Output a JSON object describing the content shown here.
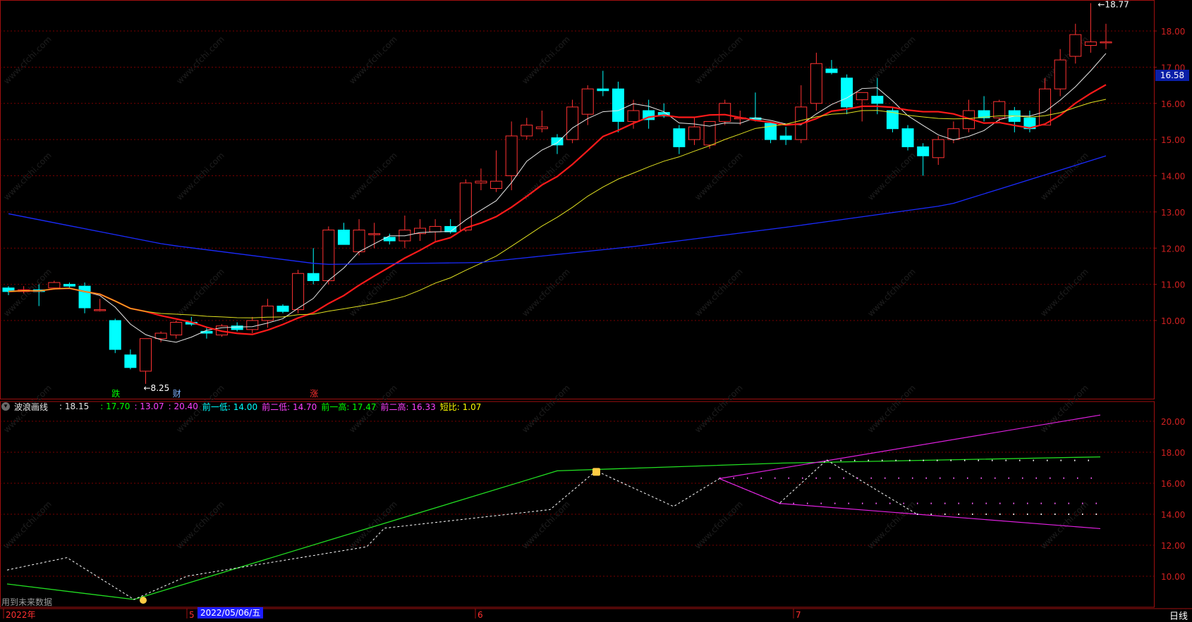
{
  "period_label": "日线",
  "footer_note": "用到未来数据",
  "current_price_tag": "16.58",
  "main_chart": {
    "y_ticks": [
      "18.00",
      "17.00",
      "16.00",
      "15.00",
      "14.00",
      "13.00",
      "12.00",
      "11.00",
      "10.00"
    ],
    "high_label": "18.77",
    "low_label": "8.25",
    "markers": [
      {
        "text": "跌",
        "color": "#00ff00"
      },
      {
        "text": "财",
        "color": "#7fb2ff"
      },
      {
        "text": "涨",
        "color": "#ff3030"
      }
    ]
  },
  "indicator": {
    "name": "波浪画线",
    "value_label": ": 18.15",
    "values": [
      {
        "text": ": 17.70",
        "color": "#00ff00"
      },
      {
        "text": ": 13.07",
        "color": "#ff40ff"
      },
      {
        "text": ": 20.40",
        "color": "#ff40ff"
      },
      {
        "text": "前一低: 14.00",
        "color": "#00ffff"
      },
      {
        "text": "前二低: 14.70",
        "color": "#ff40ff"
      },
      {
        "text": "前一高: 17.47",
        "color": "#00ff00"
      },
      {
        "text": "前二高: 16.33",
        "color": "#ff40ff"
      },
      {
        "text": "短比: 1.07",
        "color": "#ffff00"
      }
    ],
    "y_ticks": [
      "20.00",
      "18.00",
      "16.00",
      "14.00",
      "12.00",
      "10.00"
    ]
  },
  "x_axis": {
    "labels": [
      "2022年",
      "5",
      "2022/05/06/五",
      "6",
      "7"
    ]
  },
  "watermark": "www.cfchi.com",
  "chart_data": {
    "type": "candlestick",
    "ylim": [
      8.1,
      18.9
    ],
    "candles": [
      [
        10.9,
        10.95,
        10.7,
        10.8
      ],
      [
        10.8,
        10.95,
        10.75,
        10.85
      ],
      [
        10.85,
        11.0,
        10.4,
        10.8
      ],
      [
        10.9,
        11.1,
        10.85,
        11.05
      ],
      [
        11.0,
        11.05,
        10.9,
        10.95
      ],
      [
        10.95,
        11.05,
        10.2,
        10.35
      ],
      [
        10.3,
        10.6,
        10.25,
        10.3
      ],
      [
        10.0,
        10.05,
        9.1,
        9.2
      ],
      [
        9.05,
        9.2,
        8.65,
        8.7
      ],
      [
        8.6,
        9.5,
        8.25,
        9.5
      ],
      [
        9.5,
        9.7,
        9.4,
        9.65
      ],
      [
        9.6,
        10.0,
        9.5,
        9.95
      ],
      [
        9.95,
        10.1,
        9.85,
        9.9
      ],
      [
        9.7,
        9.8,
        9.5,
        9.65
      ],
      [
        9.6,
        9.9,
        9.55,
        9.85
      ],
      [
        9.85,
        9.95,
        9.7,
        9.75
      ],
      [
        9.75,
        10.1,
        9.65,
        10.0
      ],
      [
        10.0,
        10.6,
        9.8,
        10.4
      ],
      [
        10.4,
        10.45,
        10.2,
        10.25
      ],
      [
        10.3,
        11.4,
        10.2,
        11.3
      ],
      [
        11.3,
        12.0,
        11.0,
        11.1
      ],
      [
        11.1,
        12.6,
        11.0,
        12.5
      ],
      [
        12.5,
        12.7,
        12.1,
        12.1
      ],
      [
        11.9,
        12.8,
        11.8,
        12.5
      ],
      [
        12.4,
        12.7,
        12.0,
        12.4
      ],
      [
        12.3,
        12.4,
        12.1,
        12.2
      ],
      [
        12.2,
        12.9,
        12.0,
        12.5
      ],
      [
        12.4,
        12.8,
        12.2,
        12.55
      ],
      [
        12.45,
        12.8,
        12.2,
        12.6
      ],
      [
        12.6,
        12.8,
        12.4,
        12.45
      ],
      [
        12.5,
        13.9,
        12.45,
        13.8
      ],
      [
        13.8,
        14.2,
        13.6,
        13.85
      ],
      [
        13.65,
        14.7,
        13.55,
        13.85
      ],
      [
        14.0,
        15.5,
        13.6,
        15.1
      ],
      [
        15.1,
        15.6,
        15.0,
        15.4
      ],
      [
        15.3,
        15.8,
        15.2,
        15.35
      ],
      [
        15.05,
        15.15,
        14.6,
        14.85
      ],
      [
        15.0,
        16.1,
        14.9,
        15.9
      ],
      [
        15.7,
        16.5,
        15.4,
        16.4
      ],
      [
        16.4,
        16.9,
        16.2,
        16.35
      ],
      [
        16.4,
        16.6,
        15.2,
        15.5
      ],
      [
        15.5,
        16.1,
        15.3,
        15.8
      ],
      [
        15.8,
        16.1,
        15.3,
        15.55
      ],
      [
        15.75,
        16.0,
        15.6,
        15.65
      ],
      [
        15.3,
        15.4,
        14.6,
        14.8
      ],
      [
        15.0,
        15.6,
        14.85,
        15.35
      ],
      [
        14.85,
        15.4,
        14.75,
        15.5
      ],
      [
        15.5,
        16.1,
        15.4,
        16.0
      ],
      [
        15.6,
        15.8,
        15.4,
        15.6
      ],
      [
        15.6,
        16.3,
        15.5,
        15.55
      ],
      [
        15.45,
        15.5,
        14.9,
        15.0
      ],
      [
        15.1,
        15.35,
        14.85,
        15.0
      ],
      [
        15.0,
        16.5,
        14.9,
        15.9
      ],
      [
        16.0,
        17.4,
        15.8,
        17.1
      ],
      [
        16.95,
        17.2,
        16.8,
        16.85
      ],
      [
        16.7,
        16.8,
        15.7,
        15.9
      ],
      [
        16.1,
        16.3,
        15.5,
        16.3
      ],
      [
        16.2,
        16.7,
        15.7,
        16.0
      ],
      [
        15.8,
        15.9,
        15.2,
        15.3
      ],
      [
        15.3,
        15.4,
        14.7,
        14.8
      ],
      [
        14.8,
        14.9,
        14.0,
        14.55
      ],
      [
        14.5,
        15.1,
        14.3,
        15.0
      ],
      [
        15.0,
        15.5,
        14.9,
        15.3
      ],
      [
        15.3,
        16.1,
        15.2,
        15.8
      ],
      [
        15.8,
        16.2,
        15.5,
        15.6
      ],
      [
        15.6,
        16.1,
        15.5,
        16.05
      ],
      [
        15.8,
        15.9,
        15.2,
        15.5
      ],
      [
        15.6,
        15.8,
        15.2,
        15.3
      ],
      [
        15.4,
        16.7,
        15.4,
        16.4
      ],
      [
        16.4,
        17.5,
        16.2,
        17.2
      ],
      [
        17.3,
        18.2,
        17.1,
        17.9
      ],
      [
        17.6,
        18.77,
        17.4,
        17.7
      ],
      [
        17.7,
        18.2,
        17.5,
        17.7
      ]
    ]
  }
}
